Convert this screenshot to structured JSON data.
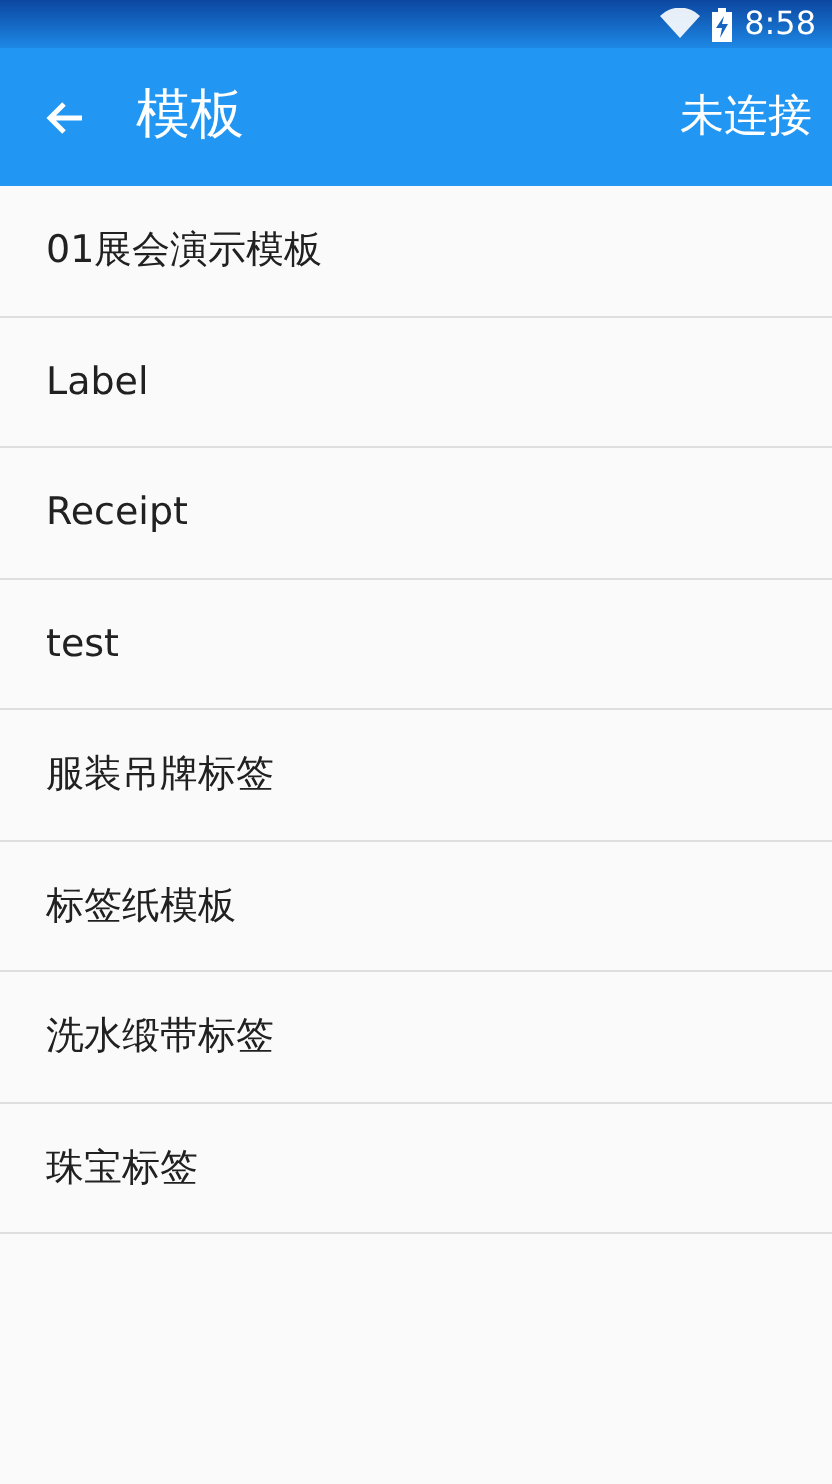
{
  "status_bar": {
    "time": "8:58"
  },
  "toolbar": {
    "title": "模板",
    "action": "未连接"
  },
  "templates": [
    {
      "name": "01展会演示模板"
    },
    {
      "name": "Label"
    },
    {
      "name": "Receipt"
    },
    {
      "name": "test"
    },
    {
      "name": "服装吊牌标签"
    },
    {
      "name": "标签纸模板"
    },
    {
      "name": "洗水缎带标签"
    },
    {
      "name": "珠宝标签"
    }
  ]
}
